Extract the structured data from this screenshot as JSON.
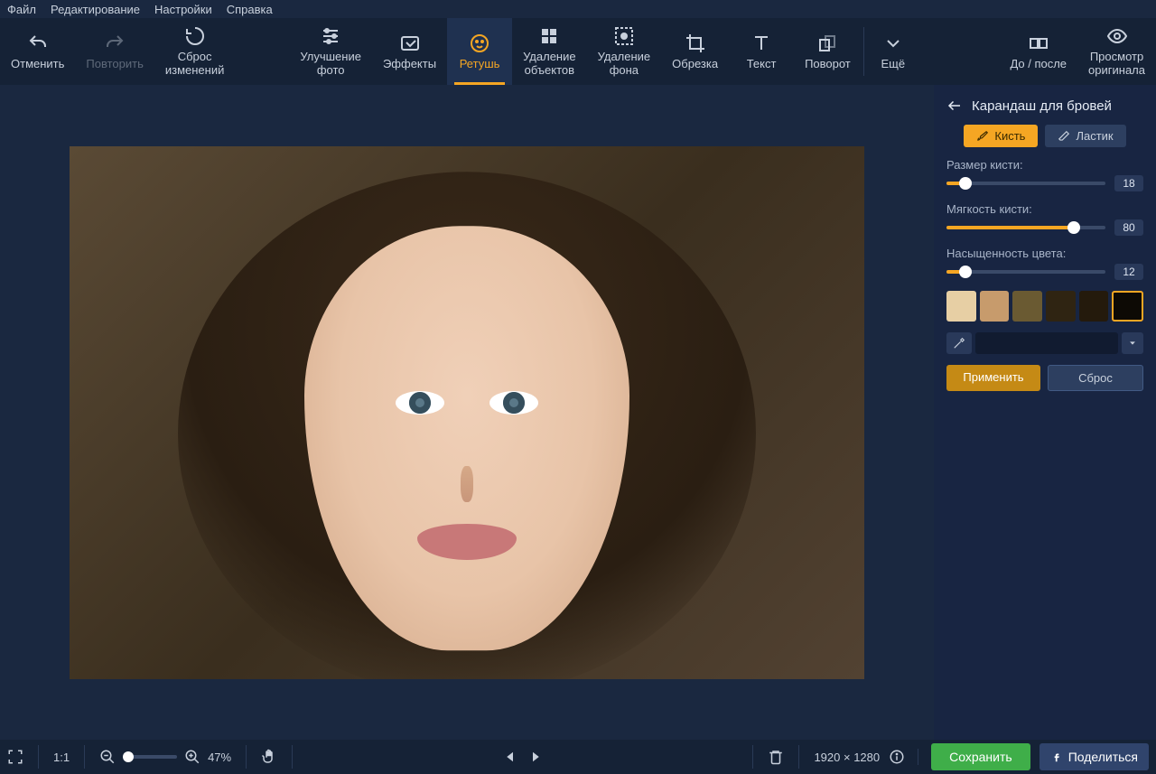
{
  "menubar": {
    "file": "Файл",
    "edit": "Редактирование",
    "settings": "Настройки",
    "help": "Справка"
  },
  "toolbar": {
    "undo": "Отменить",
    "redo": "Повторить",
    "reset": "Сброс\nизменений",
    "enhance": "Улучшение\nфото",
    "effects": "Эффекты",
    "retouch": "Ретушь",
    "remove_obj": "Удаление\nобъектов",
    "remove_bg": "Удаление\nфона",
    "crop": "Обрезка",
    "text": "Текст",
    "rotate": "Поворот",
    "more": "Ещё",
    "before_after": "До / после",
    "view_original": "Просмотр\nоригинала"
  },
  "panel": {
    "title": "Карандаш для бровей",
    "brush": "Кисть",
    "eraser": "Ластик",
    "sliders": {
      "size_label": "Размер кисти:",
      "size_value": "18",
      "size_pct": 12,
      "soft_label": "Мягкость кисти:",
      "soft_value": "80",
      "soft_pct": 80,
      "sat_label": "Насыщенность цвета:",
      "sat_value": "12",
      "sat_pct": 12
    },
    "swatches": [
      "#e7cfa4",
      "#c79b6c",
      "#6a5a32",
      "#2f2412",
      "#241a0c",
      "#0d0a05"
    ],
    "apply": "Применить",
    "reset": "Сброс"
  },
  "bottombar": {
    "scale11": "1:1",
    "zoom_pct": "47%",
    "image_dims": "1920 × 1280",
    "save": "Сохранить",
    "share": "Поделиться"
  }
}
